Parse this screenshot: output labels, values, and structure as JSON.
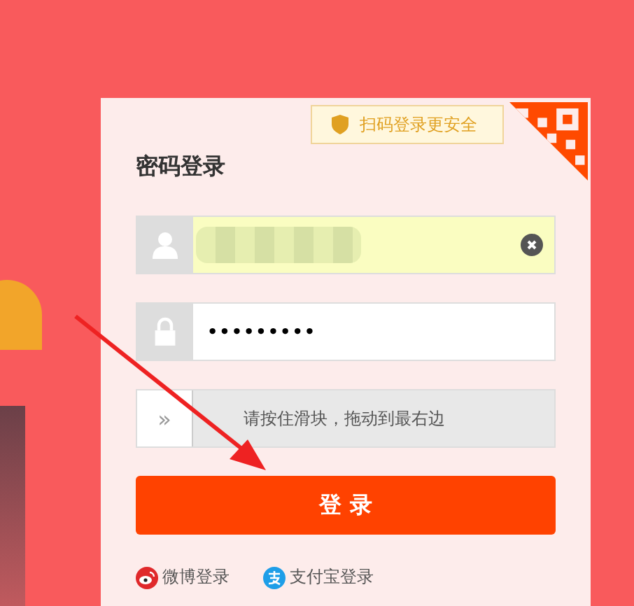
{
  "qr_hint": {
    "label": "扫码登录更安全"
  },
  "title": "密码登录",
  "username": {
    "filled": true,
    "autofilled": true
  },
  "password": {
    "value": "•••••••••"
  },
  "slider": {
    "handle": "»",
    "hint": "请按住滑块，拖动到最右边",
    "level": 0
  },
  "login_button": "登 录",
  "alt_logins": [
    {
      "kind": "weibo",
      "label": "微博登录"
    },
    {
      "kind": "alipay",
      "label": "支付宝登录"
    }
  ]
}
